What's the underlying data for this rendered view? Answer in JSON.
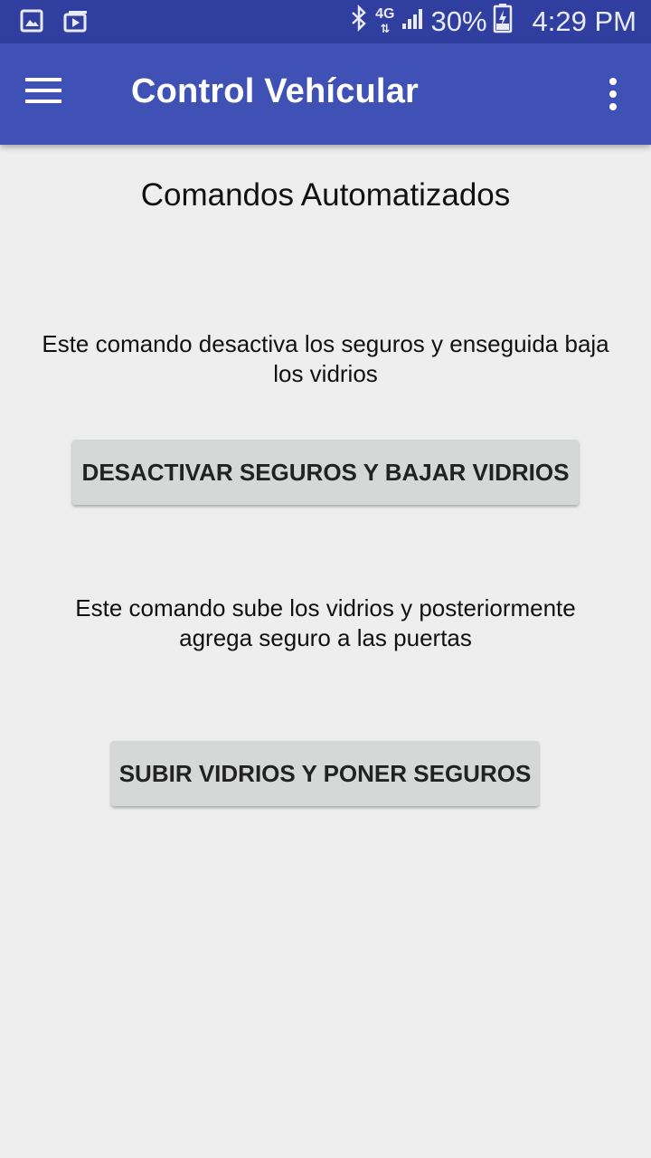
{
  "status_bar": {
    "icons_left": [
      "gallery-icon",
      "media-icon"
    ],
    "icons_right": [
      "bluetooth-icon",
      "network-4g-icon",
      "signal-icon",
      "battery-charging-icon"
    ],
    "network_label": "4G",
    "battery": "30%",
    "time": "4:29 PM"
  },
  "app_bar": {
    "title": "Control Vehícular",
    "menu_icon": "hamburger-menu-icon",
    "overflow_icon": "more-vert-icon"
  },
  "main": {
    "heading": "Comandos Automatizados",
    "commands": [
      {
        "description": "Este comando desactiva los seguros y enseguida baja los vidrios",
        "button_label": "DESACTIVAR SEGUROS Y BAJAR VIDRIOS"
      },
      {
        "description": "Este comando sube los vidrios y posteriormente agrega seguro a las puertas",
        "button_label": "SUBIR VIDRIOS Y PONER SEGUROS"
      }
    ]
  },
  "colors": {
    "status_bar": "#303f9f",
    "app_bar": "#3f51b5",
    "background": "#eeeeee",
    "button": "#d6d7d7"
  }
}
